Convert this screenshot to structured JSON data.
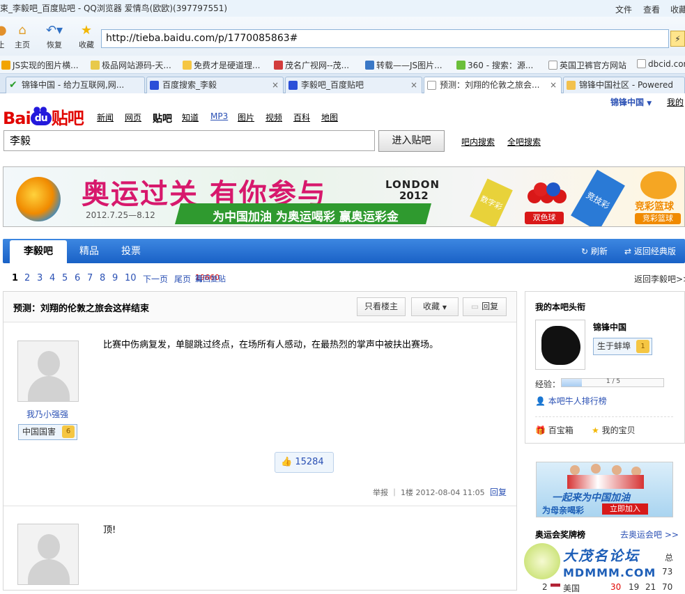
{
  "window": {
    "title": "束_李毅吧_百度贴吧 - QQ浏览器 爱情鸟(欧欧)(397797551)",
    "menu": [
      "文件",
      "查看",
      "收藏"
    ]
  },
  "toolbar": {
    "home": "主页",
    "restore": "恢复",
    "favorites": "收藏",
    "left_label": "止",
    "url": "http://tieba.baidu.com/p/1770085863#"
  },
  "favbar": [
    "JS实现的图片横...",
    "极品网站源码-天...",
    "免费才是硬道理...",
    "茂名广视网--茂...",
    "转载——JS图片...",
    "360 - 搜索：源...",
    "英国卫裤官方网站",
    "dbcid.com"
  ],
  "tabs": [
    "锦锋中国 - 给力互联网,网...",
    "百度搜索_李毅",
    "李毅吧_百度贴吧",
    "预测：刘翔的伦敦之旅会...",
    "锦锋中国社区 - Powered"
  ],
  "userbar": {
    "user": "锦锋中国",
    "mine": "我的"
  },
  "logo": {
    "bai": "Bai",
    "du": "du",
    "tieba": "贴吧"
  },
  "nav": [
    "新闻",
    "网页",
    "贴吧",
    "知道",
    "MP3",
    "图片",
    "视频",
    "百科",
    "地图"
  ],
  "search": {
    "value": "李毅",
    "button": "进入贴吧",
    "in_bar": "吧内搜索",
    "all_bar": "全吧搜索"
  },
  "banner": {
    "title": "奥运过关 有你参与",
    "date": "2012.7.25—8.12",
    "slogan": "为中国加油 为奥运喝彩 赢奥运彩金",
    "london": "LONDON",
    "year": "2012",
    "b1": "数字彩",
    "b2": "双色球",
    "b3": "竞技彩",
    "b4": "竞彩篮球",
    "b5": "竞彩篮球"
  },
  "bar_tabs": {
    "home": "李毅吧",
    "good": "精品",
    "vote": "投票",
    "refresh": "刷新",
    "classic": "返回经典版"
  },
  "pager": {
    "pages": [
      "1",
      "2",
      "3",
      "4",
      "5",
      "6",
      "7",
      "8",
      "9",
      "10"
    ],
    "next": "下一页",
    "last": "尾页",
    "count_pre": "有",
    "count": "19660",
    "count_post": "篇回复贴",
    "back": "返回李毅吧>>"
  },
  "thread": {
    "title": "预测：刘翔的伦敦之旅会这样结束",
    "only_author": "只看楼主",
    "collect": "收藏",
    "reply": "回复"
  },
  "post1": {
    "author": "我乃小强强",
    "badge": "中国国害",
    "level": "6",
    "content": "比赛中伤病复发，单腿跳过终点，在场所有人感动，在最热烈的掌声中被扶出赛场。",
    "likes": "15284",
    "report": "举报",
    "floor": "1楼",
    "time": "2012-08-04 11:05",
    "reply": "回复"
  },
  "post2": {
    "content": "顶!"
  },
  "side": {
    "title": "我的本吧头衔",
    "username": "锦锋中国",
    "badge": "生于蚌埠",
    "level": "1",
    "exp_label": "经验：",
    "exp_value": "1 / 5",
    "exp_fraction": 0.2,
    "rank": "本吧牛人排行榜",
    "treasure": "百宝箱",
    "mine": "我的宝贝"
  },
  "ad": {
    "line1": "一起来为中国加油",
    "line2": "为母亲喝彩",
    "button": "立即加入"
  },
  "medals": {
    "title": "奥运会奖牌榜",
    "link": "去奥运会吧 >>",
    "total_header": "总",
    "row1_total": "73",
    "row2_rank": "2",
    "row2_country": "美国",
    "row2_gold": "30",
    "row2_silver": "19",
    "row2_bronze": "21",
    "row2_total": "70"
  },
  "watermark": {
    "line1": "大茂名论坛",
    "line2": "MDMMM.COM"
  }
}
